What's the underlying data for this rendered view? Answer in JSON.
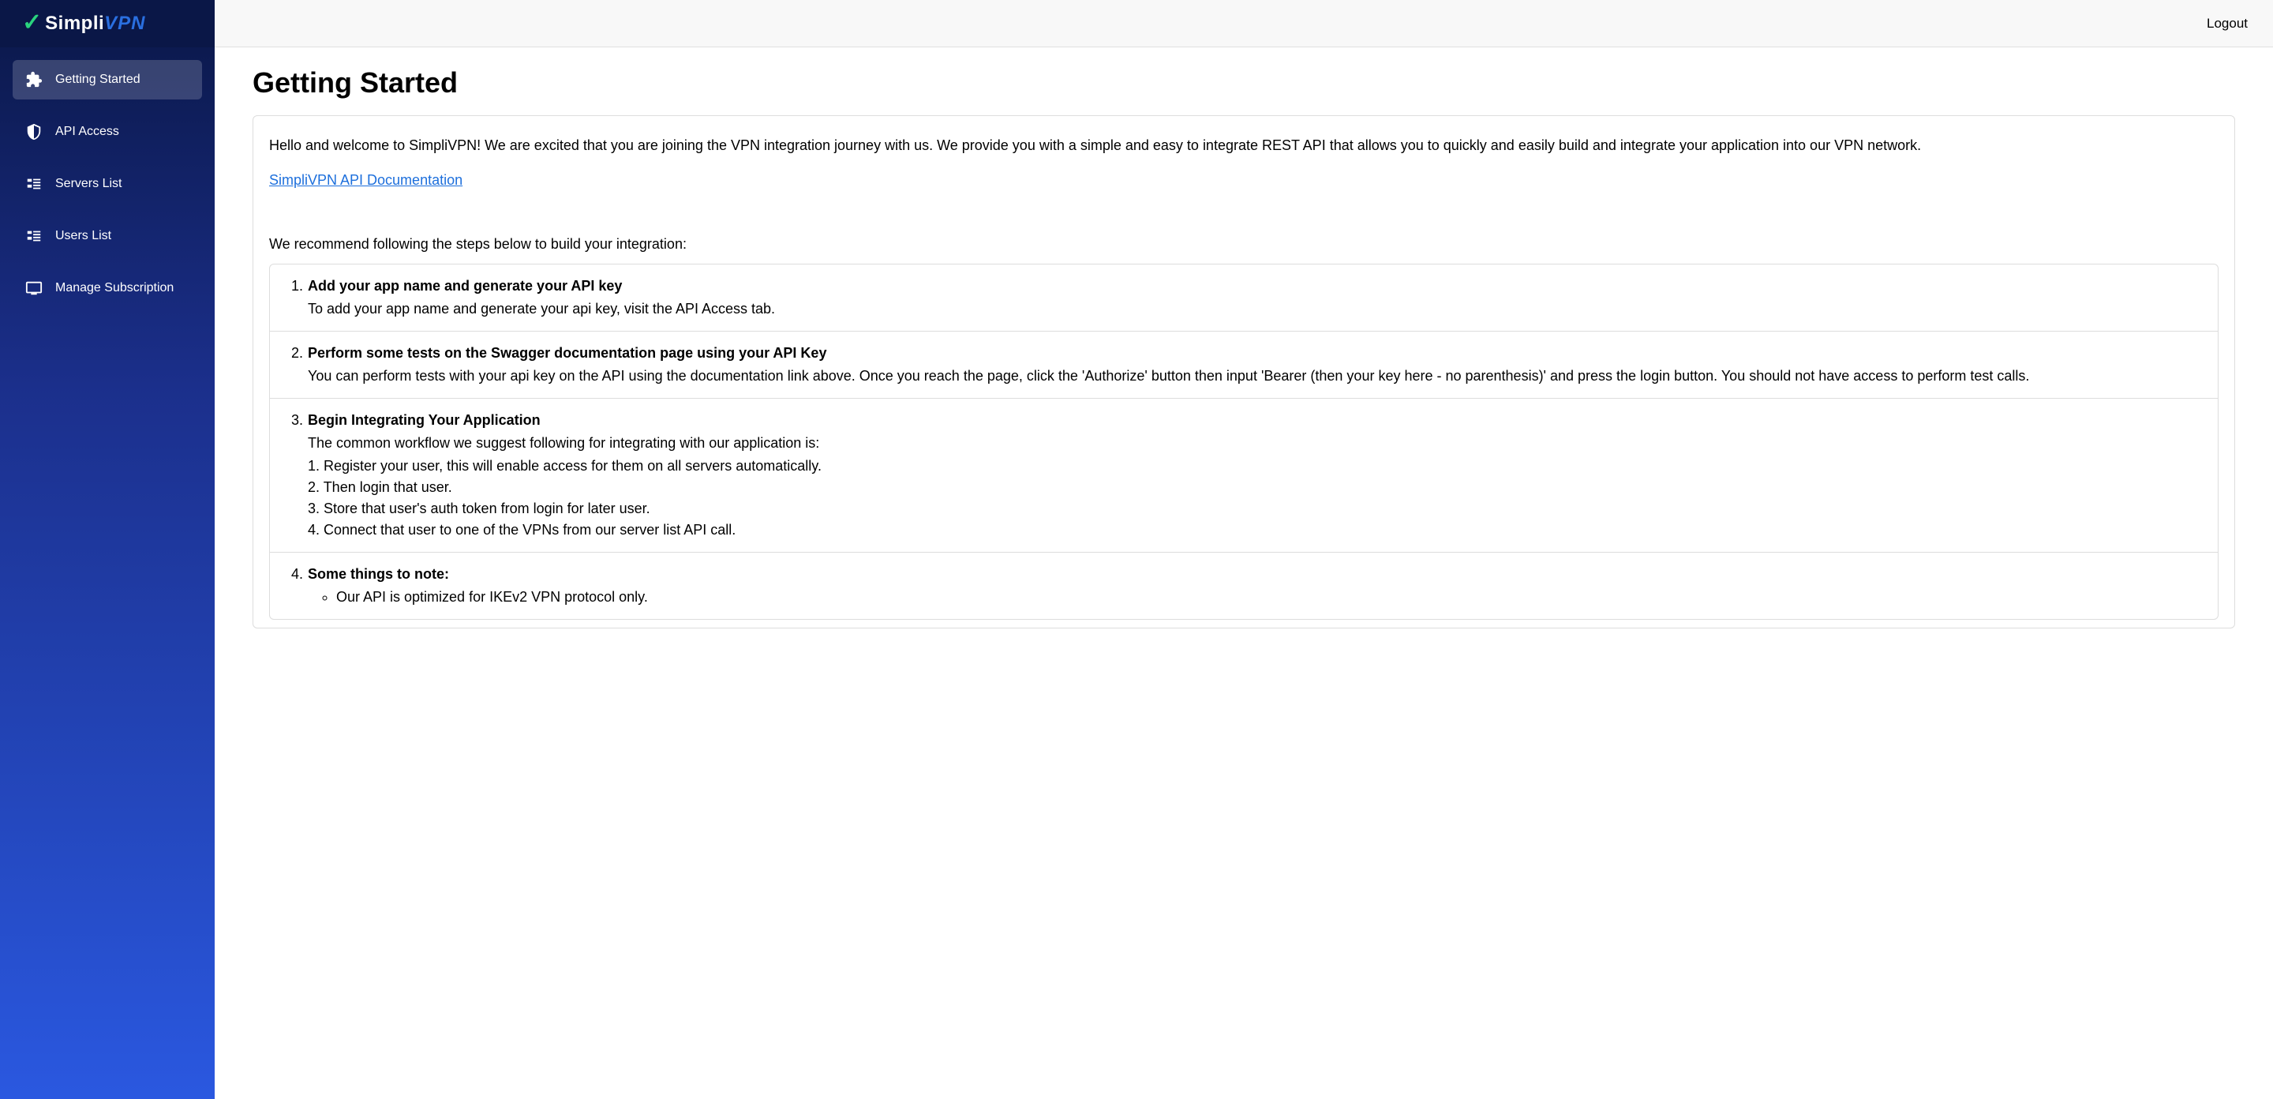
{
  "brand": {
    "name_primary": "Simpli",
    "name_secondary": "VPN"
  },
  "topbar": {
    "logout": "Logout"
  },
  "sidebar": {
    "items": [
      {
        "label": "Getting Started"
      },
      {
        "label": "API Access"
      },
      {
        "label": "Servers List"
      },
      {
        "label": "Users List"
      },
      {
        "label": "Manage Subscription"
      }
    ]
  },
  "page": {
    "title": "Getting Started",
    "intro": "Hello and welcome to SimpliVPN! We are excited that you are joining the VPN integration journey with us. We provide you with a simple and easy to integrate REST API that allows you to quickly and easily build and integrate your application into our VPN network.",
    "doc_link_label": "SimpliVPN API Documentation",
    "recommend": "We recommend following the steps below to build your integration:",
    "steps": [
      {
        "num": "1.",
        "title": "Add your app name and generate your API key",
        "desc": "To add your app name and generate your api key, visit the API Access tab."
      },
      {
        "num": "2.",
        "title": "Perform some tests on the Swagger documentation page using your API Key",
        "desc": "You can perform tests with your api key on the API using the documentation link above. Once you reach the page, click the 'Authorize' button then input 'Bearer (then your key here - no parenthesis)' and press the login button. You should not have access to perform test calls."
      },
      {
        "num": "3.",
        "title": "Begin Integrating Your Application",
        "desc": "The common workflow we suggest following for integrating with our application is:",
        "substeps": [
          "1. Register your user, this will enable access for them on all servers automatically.",
          "2. Then login that user.",
          "3. Store that user's auth token from login for later user.",
          "4. Connect that user to one of the VPNs from our server list API call."
        ]
      },
      {
        "num": "4.",
        "title": "Some things to note:",
        "bullets": [
          "Our API is optimized for IKEv2 VPN protocol only."
        ]
      }
    ]
  }
}
